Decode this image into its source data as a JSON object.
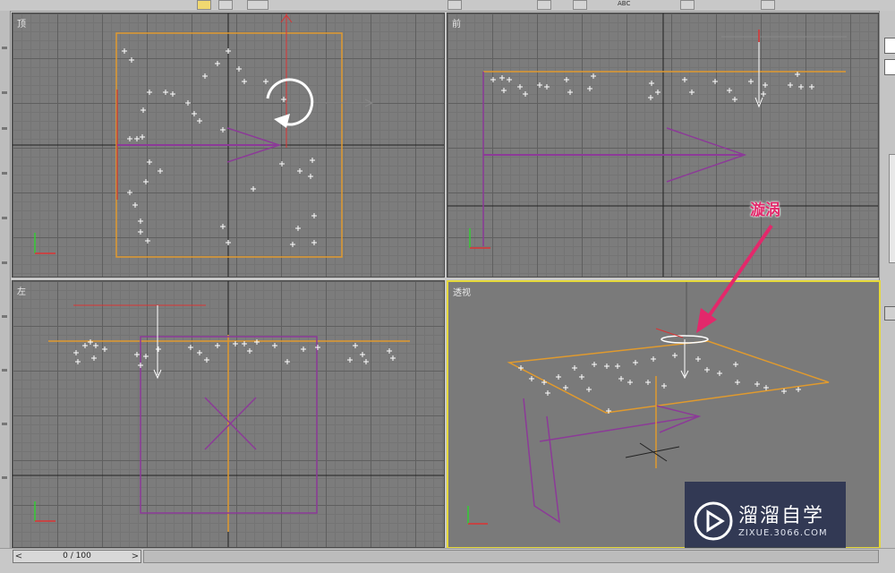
{
  "viewports": {
    "top": {
      "label": "顶"
    },
    "front": {
      "label": "前"
    },
    "left": {
      "label": "左"
    },
    "perspective": {
      "label": "透视"
    }
  },
  "annotation": {
    "label": "漩涡"
  },
  "timebar": {
    "position_text": "0 / 100",
    "prev": "<",
    "next": ">"
  },
  "watermark": {
    "name": "溜溜自学",
    "url": "ZIXUE.3066.COM"
  },
  "toolbar": {
    "abc_label": "ABC"
  },
  "colors": {
    "viewport_bg": "#7c7c7c",
    "grid": "#5f5f5f",
    "gizmo_orange": "#e09a2e",
    "gizmo_purple": "#8c3a98",
    "active_border": "#e6d93a",
    "annotation": "#e3286b"
  }
}
